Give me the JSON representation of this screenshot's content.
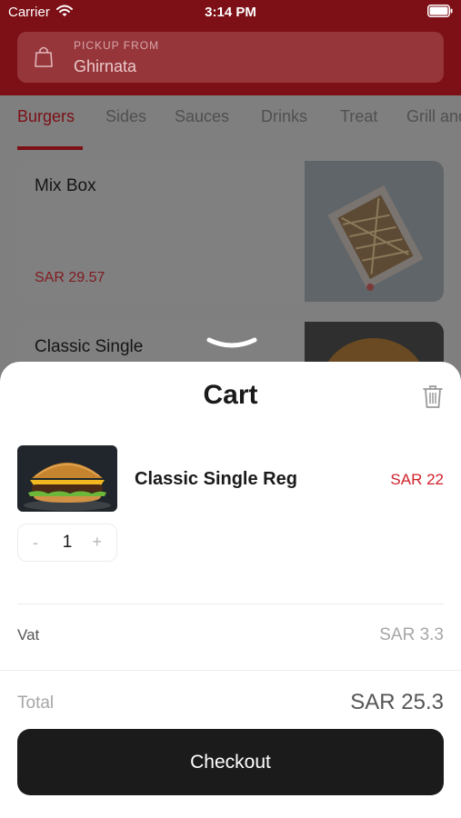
{
  "status_bar": {
    "carrier": "Carrier",
    "time": "3:14 PM"
  },
  "header": {
    "pickup_label": "PICKUP FROM",
    "pickup_value": "Ghirnata"
  },
  "tabs": [
    {
      "label": "Burgers",
      "active": true
    },
    {
      "label": "Sides"
    },
    {
      "label": "Sauces"
    },
    {
      "label": "Drinks"
    },
    {
      "label": "Treat"
    },
    {
      "label": "Grill and"
    }
  ],
  "menu": [
    {
      "title": "Mix Box",
      "price": "SAR 29.57"
    },
    {
      "title": "Classic Single"
    }
  ],
  "cart": {
    "title": "Cart",
    "item": {
      "name": "Classic Single Reg",
      "price": "SAR 22",
      "quantity": "1",
      "minus": "-",
      "plus": "+"
    },
    "vat_label": "Vat",
    "vat_value": "SAR 3.3",
    "total_label": "Total",
    "total_value": "SAR 25.3",
    "checkout_label": "Checkout"
  },
  "colors": {
    "brand": "#C8161D",
    "brand_dimmed": "#7C1016",
    "price_red": "#D0202A",
    "checkout_bg": "#1B1B1B"
  }
}
